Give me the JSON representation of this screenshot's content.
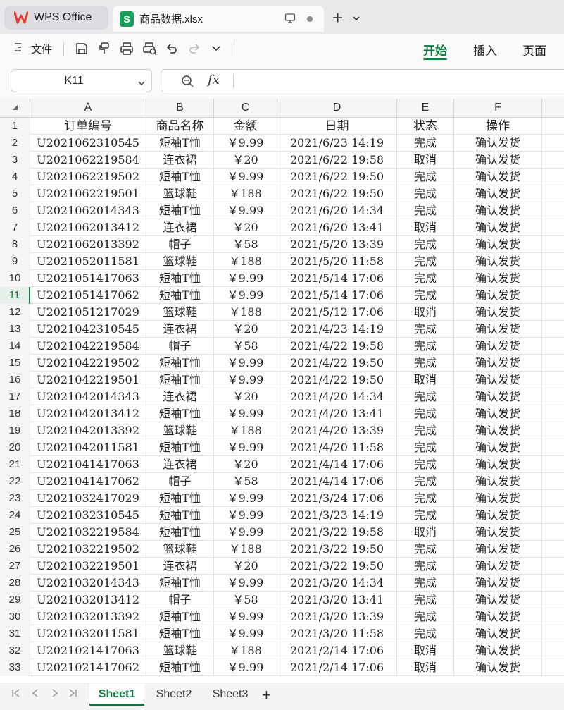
{
  "titlebar": {
    "app_tab_label": "WPS Office",
    "file_tab_label": "商品数据.xlsx",
    "new_tab_symbol": "+"
  },
  "toolbar": {
    "menu_label": "文件",
    "ribbon_tabs": [
      "开始",
      "插入",
      "页面"
    ],
    "active_tab": "开始"
  },
  "formula_bar": {
    "name_box": "K11",
    "fx_label": "fx",
    "formula": ""
  },
  "sheet": {
    "columns": [
      "A",
      "B",
      "C",
      "D",
      "E",
      "F"
    ],
    "selected_row": 11,
    "rows": [
      {
        "n": "1",
        "a": "订单编号",
        "b": "商品名称",
        "c": "金额",
        "d": "日期",
        "e": "状态",
        "f": "操作"
      },
      {
        "n": "2",
        "a": "U2021062310545",
        "b": "短袖T恤",
        "c": "￥9.99",
        "d": "2021/6/23 14:19",
        "e": "完成",
        "f": "确认发货"
      },
      {
        "n": "3",
        "a": "U2021062219584",
        "b": "连衣裙",
        "c": "￥20",
        "d": "2021/6/22 19:58",
        "e": "取消",
        "f": "确认发货"
      },
      {
        "n": "4",
        "a": "U2021062219502",
        "b": "短袖T恤",
        "c": "￥9.99",
        "d": "2021/6/22 19:50",
        "e": "完成",
        "f": "确认发货"
      },
      {
        "n": "5",
        "a": "U2021062219501",
        "b": "篮球鞋",
        "c": "￥188",
        "d": "2021/6/22 19:50",
        "e": "完成",
        "f": "确认发货"
      },
      {
        "n": "6",
        "a": "U2021062014343",
        "b": "短袖T恤",
        "c": "￥9.99",
        "d": "2021/6/20 14:34",
        "e": "完成",
        "f": "确认发货"
      },
      {
        "n": "7",
        "a": "U2021062013412",
        "b": "连衣裙",
        "c": "￥20",
        "d": "2021/6/20 13:41",
        "e": "取消",
        "f": "确认发货"
      },
      {
        "n": "8",
        "a": "U2021062013392",
        "b": "帽子",
        "c": "￥58",
        "d": "2021/5/20 13:39",
        "e": "完成",
        "f": "确认发货"
      },
      {
        "n": "9",
        "a": "U2021052011581",
        "b": "篮球鞋",
        "c": "￥188",
        "d": "2021/5/20 11:58",
        "e": "完成",
        "f": "确认发货"
      },
      {
        "n": "10",
        "a": "U2021051417063",
        "b": "短袖T恤",
        "c": "￥9.99",
        "d": "2021/5/14 17:06",
        "e": "完成",
        "f": "确认发货"
      },
      {
        "n": "11",
        "a": "U2021051417062",
        "b": "短袖T恤",
        "c": "￥9.99",
        "d": "2021/5/14 17:06",
        "e": "完成",
        "f": "确认发货"
      },
      {
        "n": "12",
        "a": "U2021051217029",
        "b": "篮球鞋",
        "c": "￥188",
        "d": "2021/5/12 17:06",
        "e": "取消",
        "f": "确认发货"
      },
      {
        "n": "13",
        "a": "U2021042310545",
        "b": "连衣裙",
        "c": "￥20",
        "d": "2021/4/23 14:19",
        "e": "完成",
        "f": "确认发货"
      },
      {
        "n": "14",
        "a": "U2021042219584",
        "b": "帽子",
        "c": "￥58",
        "d": "2021/4/22 19:58",
        "e": "完成",
        "f": "确认发货"
      },
      {
        "n": "15",
        "a": "U2021042219502",
        "b": "短袖T恤",
        "c": "￥9.99",
        "d": "2021/4/22 19:50",
        "e": "完成",
        "f": "确认发货"
      },
      {
        "n": "16",
        "a": "U2021042219501",
        "b": "短袖T恤",
        "c": "￥9.99",
        "d": "2021/4/22 19:50",
        "e": "取消",
        "f": "确认发货"
      },
      {
        "n": "17",
        "a": "U2021042014343",
        "b": "连衣裙",
        "c": "￥20",
        "d": "2021/4/20 14:34",
        "e": "完成",
        "f": "确认发货"
      },
      {
        "n": "18",
        "a": "U2021042013412",
        "b": "短袖T恤",
        "c": "￥9.99",
        "d": "2021/4/20 13:41",
        "e": "完成",
        "f": "确认发货"
      },
      {
        "n": "19",
        "a": "U2021042013392",
        "b": "篮球鞋",
        "c": "￥188",
        "d": "2021/4/20 13:39",
        "e": "完成",
        "f": "确认发货"
      },
      {
        "n": "20",
        "a": "U2021042011581",
        "b": "短袖T恤",
        "c": "￥9.99",
        "d": "2021/4/20 11:58",
        "e": "完成",
        "f": "确认发货"
      },
      {
        "n": "21",
        "a": "U2021041417063",
        "b": "连衣裙",
        "c": "￥20",
        "d": "2021/4/14 17:06",
        "e": "完成",
        "f": "确认发货"
      },
      {
        "n": "22",
        "a": "U2021041417062",
        "b": "帽子",
        "c": "￥58",
        "d": "2021/4/14 17:06",
        "e": "完成",
        "f": "确认发货"
      },
      {
        "n": "23",
        "a": "U2021032417029",
        "b": "短袖T恤",
        "c": "￥9.99",
        "d": "2021/3/24 17:06",
        "e": "完成",
        "f": "确认发货"
      },
      {
        "n": "24",
        "a": "U2021032310545",
        "b": "短袖T恤",
        "c": "￥9.99",
        "d": "2021/3/23 14:19",
        "e": "完成",
        "f": "确认发货"
      },
      {
        "n": "25",
        "a": "U2021032219584",
        "b": "短袖T恤",
        "c": "￥9.99",
        "d": "2021/3/22 19:58",
        "e": "取消",
        "f": "确认发货"
      },
      {
        "n": "26",
        "a": "U2021032219502",
        "b": "篮球鞋",
        "c": "￥188",
        "d": "2021/3/22 19:50",
        "e": "完成",
        "f": "确认发货"
      },
      {
        "n": "27",
        "a": "U2021032219501",
        "b": "连衣裙",
        "c": "￥20",
        "d": "2021/3/22 19:50",
        "e": "完成",
        "f": "确认发货"
      },
      {
        "n": "28",
        "a": "U2021032014343",
        "b": "短袖T恤",
        "c": "￥9.99",
        "d": "2021/3/20 14:34",
        "e": "完成",
        "f": "确认发货"
      },
      {
        "n": "29",
        "a": "U2021032013412",
        "b": "帽子",
        "c": "￥58",
        "d": "2021/3/20 13:41",
        "e": "完成",
        "f": "确认发货"
      },
      {
        "n": "30",
        "a": "U2021032013392",
        "b": "短袖T恤",
        "c": "￥9.99",
        "d": "2021/3/20 13:39",
        "e": "完成",
        "f": "确认发货"
      },
      {
        "n": "31",
        "a": "U2021032011581",
        "b": "短袖T恤",
        "c": "￥9.99",
        "d": "2021/3/20 11:58",
        "e": "完成",
        "f": "确认发货"
      },
      {
        "n": "32",
        "a": "U2021021417063",
        "b": "篮球鞋",
        "c": "￥188",
        "d": "2021/2/14 17:06",
        "e": "取消",
        "f": "确认发货"
      },
      {
        "n": "33",
        "a": "U2021021417062",
        "b": "短袖T恤",
        "c": "￥9.99",
        "d": "2021/2/14 17:06",
        "e": "取消",
        "f": "确认发货"
      }
    ]
  },
  "sheet_tabs": {
    "tabs": [
      "Sheet1",
      "Sheet2",
      "Sheet3"
    ],
    "active": "Sheet1",
    "add_symbol": "+"
  },
  "colors": {
    "accent": "#107c41",
    "file_icon": "#1a9c5b",
    "wps_logo": "#e8382f"
  }
}
